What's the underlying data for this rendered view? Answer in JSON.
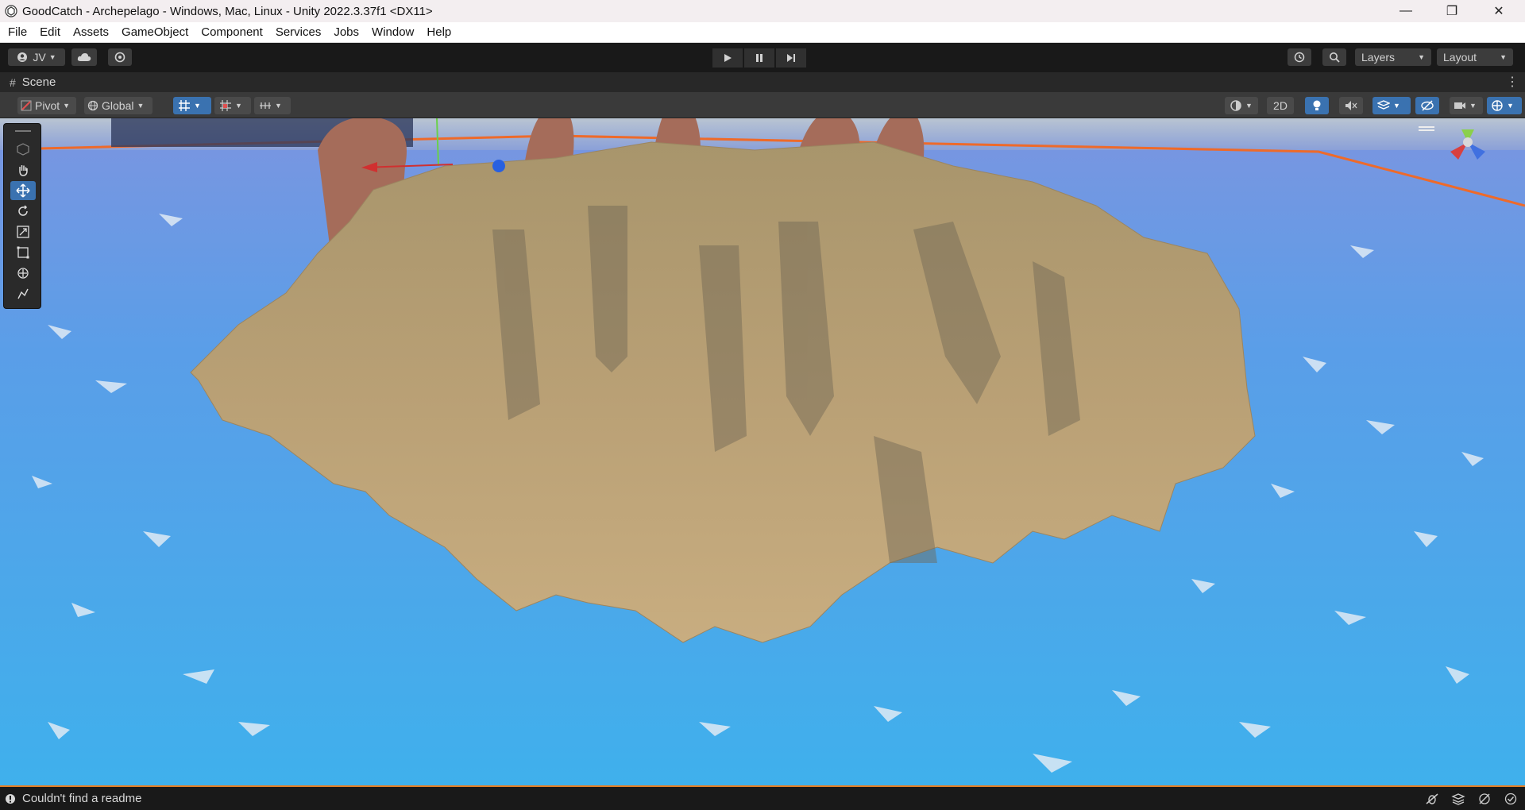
{
  "window": {
    "title": "GoodCatch - Archepelago - Windows, Mac, Linux - Unity 2022.3.37f1 <DX11>",
    "controls": {
      "minimize": "—",
      "restore": "❐",
      "close": "✕"
    }
  },
  "menu": {
    "items": [
      "File",
      "Edit",
      "Assets",
      "GameObject",
      "Component",
      "Services",
      "Jobs",
      "Window",
      "Help"
    ]
  },
  "toolbar": {
    "account": "JV",
    "layers": "Layers",
    "layout": "Layout"
  },
  "scene_tab": {
    "label": "Scene"
  },
  "scene_toolbar": {
    "pivot": "Pivot",
    "global": "Global",
    "mode_2d": "2D"
  },
  "status": {
    "message": "Couldn't find a readme"
  },
  "colors": {
    "accent": "#3a72b0",
    "status_border": "#e67e22",
    "water": "#4aa8e8",
    "terrain": "#b49a70"
  }
}
